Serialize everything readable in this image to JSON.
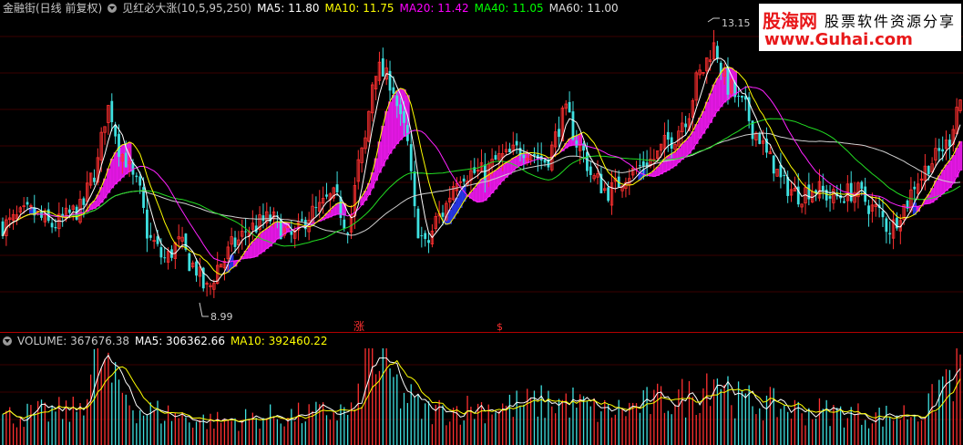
{
  "header": {
    "stock": "金融街(日线 前复权)",
    "indicator": "见红必大涨(10,5,95,250)",
    "ma": [
      {
        "label": "MA5: 11.80",
        "color": "#ffffff"
      },
      {
        "label": "MA10: 11.75",
        "color": "#ffff00"
      },
      {
        "label": "MA20: 11.42",
        "color": "#ff00ff"
      },
      {
        "label": "MA40: 11.05",
        "color": "#00ff00"
      },
      {
        "label": "MA60: 11.00",
        "color": "#dddddd"
      }
    ]
  },
  "volume_header": {
    "volume": "VOLUME: 367676.38",
    "ma5": "MA5: 306362.66",
    "ma10": "MA10: 392460.22"
  },
  "logo": {
    "line1_brand": "股海网",
    "line1_text": "股票软件资源分享",
    "line2": "www.Guhai.com"
  },
  "chart_data": [
    {
      "type": "candlestick",
      "series": [
        "MA5",
        "MA10",
        "MA20",
        "MA40",
        "MA60"
      ],
      "annotations": {
        "high_label": "13.15",
        "low_label": "8.99",
        "signal_1": "涨",
        "signal_2": "$"
      },
      "knots": [
        [
          0,
          10.05
        ],
        [
          8,
          10.25
        ],
        [
          14,
          10.05
        ],
        [
          22,
          10.3
        ],
        [
          26,
          10.9
        ],
        [
          30,
          11.95
        ],
        [
          34,
          11.2
        ],
        [
          38,
          10.7
        ],
        [
          42,
          9.8
        ],
        [
          46,
          9.5
        ],
        [
          50,
          9.75
        ],
        [
          54,
          9.4
        ],
        [
          58,
          9.0
        ],
        [
          62,
          9.45
        ],
        [
          66,
          9.75
        ],
        [
          70,
          10.0
        ],
        [
          76,
          10.15
        ],
        [
          82,
          9.85
        ],
        [
          88,
          10.25
        ],
        [
          94,
          10.5
        ],
        [
          98,
          10.05
        ],
        [
          102,
          11.2
        ],
        [
          106,
          12.6
        ],
        [
          110,
          12.4
        ],
        [
          114,
          11.6
        ],
        [
          118,
          10.0
        ],
        [
          120,
          9.7
        ],
        [
          124,
          10.2
        ],
        [
          130,
          10.9
        ],
        [
          136,
          10.9
        ],
        [
          142,
          11.15
        ],
        [
          148,
          11.3
        ],
        [
          154,
          11.1
        ],
        [
          160,
          11.85
        ],
        [
          164,
          11.3
        ],
        [
          168,
          10.8
        ],
        [
          172,
          10.6
        ],
        [
          178,
          10.9
        ],
        [
          184,
          11.1
        ],
        [
          190,
          11.45
        ],
        [
          194,
          11.8
        ],
        [
          198,
          12.5
        ],
        [
          202,
          12.95
        ],
        [
          206,
          12.3
        ],
        [
          210,
          12.0
        ],
        [
          214,
          11.55
        ],
        [
          218,
          11.1
        ],
        [
          222,
          10.7
        ],
        [
          226,
          10.55
        ],
        [
          230,
          10.65
        ],
        [
          236,
          10.5
        ],
        [
          242,
          10.6
        ],
        [
          248,
          10.3
        ],
        [
          252,
          10.0
        ],
        [
          256,
          10.35
        ],
        [
          260,
          10.8
        ],
        [
          264,
          11.1
        ],
        [
          268,
          11.35
        ],
        [
          272,
          12.1
        ]
      ],
      "volume_knots": [
        [
          0,
          0.3
        ],
        [
          20,
          0.35
        ],
        [
          28,
          0.9
        ],
        [
          32,
          0.6
        ],
        [
          40,
          0.35
        ],
        [
          60,
          0.25
        ],
        [
          80,
          0.3
        ],
        [
          100,
          0.35
        ],
        [
          104,
          0.95
        ],
        [
          108,
          0.8
        ],
        [
          114,
          0.5
        ],
        [
          120,
          0.35
        ],
        [
          140,
          0.4
        ],
        [
          160,
          0.45
        ],
        [
          170,
          0.35
        ],
        [
          196,
          0.5
        ],
        [
          202,
          0.75
        ],
        [
          210,
          0.45
        ],
        [
          230,
          0.35
        ],
        [
          250,
          0.3
        ],
        [
          262,
          0.35
        ],
        [
          268,
          0.7
        ],
        [
          272,
          0.75
        ]
      ]
    }
  ]
}
